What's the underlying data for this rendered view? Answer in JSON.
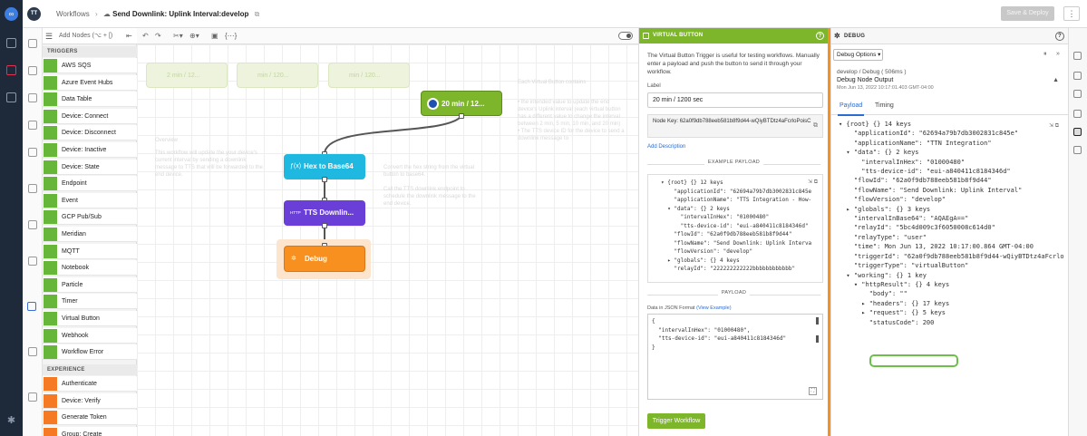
{
  "header": {
    "avatar": "TT",
    "breadcrumb_root": "Workflows",
    "breadcrumb_current": "Send Downlink: Uplink Interval:develop",
    "save_label": "Save & Deploy",
    "more_label": "⋮"
  },
  "palette": {
    "search_placeholder": "Add Nodes (⌥ + [)",
    "triggers_header": "TRIGGERS",
    "triggers": [
      "AWS SQS",
      "Azure Event Hubs",
      "Data Table",
      "Device: Connect",
      "Device: Disconnect",
      "Device: Inactive",
      "Device: State",
      "Endpoint",
      "Event",
      "GCP Pub/Sub",
      "Meridian",
      "MQTT",
      "Notebook",
      "Particle",
      "Timer",
      "Virtual Button",
      "Webhook",
      "Workflow Error"
    ],
    "experience_header": "EXPERIENCE",
    "experience": [
      "Authenticate",
      "Device: Verify",
      "Generate Token",
      "Group: Create"
    ]
  },
  "canvas": {
    "nodes": {
      "trigger": "20 min / 12...",
      "hex": "Hex to Base64",
      "tts": "TTS Downlin...",
      "debug": "Debug"
    },
    "ghost_nodes": [
      "2 min / 12...",
      "min / 120...",
      "min / 120..."
    ],
    "notes": {
      "overview_title": "Overview",
      "overview_text": "This workflow will update the your device's current interval by sending a downlink message to TTS that will be forwarded to the end device.",
      "note2": "Convert the hex string from the virtual button to base64.\n\nCall the TTS downlink endpoint to schedule the downlink message to the end device.",
      "note3_title": "Each Virtual Button contains",
      "note3_text": "• the intended value to update the end device's Uplink interval (each virtual button has a different value to change the interval between 2 min, 5 min, 10 min, and 20 min)\n• The TTS device ID for the device to send a downlink message to"
    }
  },
  "virtual_button": {
    "title": "VIRTUAL BUTTON",
    "description": "The Virtual Button Trigger is useful for testing workflows. Manually enter a payload and push the button to send it through your workflow.",
    "label_caption": "Label",
    "label_value": "20 min / 1200 sec",
    "node_key_caption": "Node Key:",
    "node_key": "62a0f9db788eeb581b8f9d44-wQiyBTDtz4aFcrloPoisC",
    "add_description": "Add Description",
    "example_payload_header": "EXAMPLE PAYLOAD",
    "example_lines": [
      "▾ {root} {} 12 keys",
      "    \"applicationId\": \"62694a79b7db3002831c845e",
      "    \"applicationName\": \"TTS Integration - How-",
      "  ▾ \"data\": {} 2 keys",
      "      \"intervalInHex\": \"01000480\"",
      "      \"tts-device-id\": \"eui-a840411c8184346d\"",
      "    \"flowId\": \"62a0f9db788eeb581b8f9d44\"",
      "    \"flowName\": \"Send Downlink: Uplink Interva",
      "    \"flowVersion\": \"develop\"",
      "  ▸ \"globals\": {} 4 keys",
      "    \"relayId\": \"222222222222bbbbbbbbbbbb\""
    ],
    "payload_header": "PAYLOAD",
    "data_json_label": "Data in JSON Format",
    "view_example": "(View Example)",
    "payload_lines": [
      "{",
      "  \"intervalInHex\": \"01000480\",",
      "  \"tts-device-id\": \"eui-a840411c8184346d\"",
      "}"
    ],
    "trigger_button": "Trigger Workflow"
  },
  "debug": {
    "title": "DEBUG",
    "options_label": "Debug Options ▾",
    "meta_path": "develop / Debug ( 506ms )",
    "meta_name": "Debug Node Output",
    "meta_time": "Mon Jun 13, 2022 10:17:01.403 GMT-04:00",
    "tab_payload": "Payload",
    "tab_timing": "Timing",
    "lines": [
      "▾ {root} {} 14 keys",
      "    \"applicationId\": \"62694a79b7db3002831c845e\"",
      "    \"applicationName\": \"TTN Integration\"",
      "  ▾ \"data\": {} 2 keys",
      "      \"intervalInHex\": \"01000480\"",
      "      \"tts-device-id\": \"eui-a840411c8184346d\"",
      "    \"flowId\": \"62a0f9db788eeb581b8f9d44\"",
      "    \"flowName\": \"Send Downlink: Uplink Interval\"",
      "    \"flowVersion\": \"develop\"",
      "  ▸ \"globals\": {} 3 keys",
      "    \"intervalInBase64\": \"AQAEgA==\"",
      "    \"relayId\": \"5bc4d009c3f6050008c614d0\"",
      "    \"relayType\": \"user\"",
      "    \"time\": Mon Jun 13, 2022 10:17:00.864 GMT-04:00",
      "    \"triggerId\": \"62a0f9db788eeb581b8f9d44-wQiyBTDtz4aFcrlo",
      "    \"triggerType\": \"virtualButton\"",
      "  ▾ \"working\": {} 1 key",
      "    ▾ \"httpResult\": {} 4 keys",
      "        \"body\": \"\"",
      "      ▸ \"headers\": {} 17 keys",
      "      ▸ \"request\": {} 5 keys",
      "        \"statusCode\": 200"
    ]
  }
}
